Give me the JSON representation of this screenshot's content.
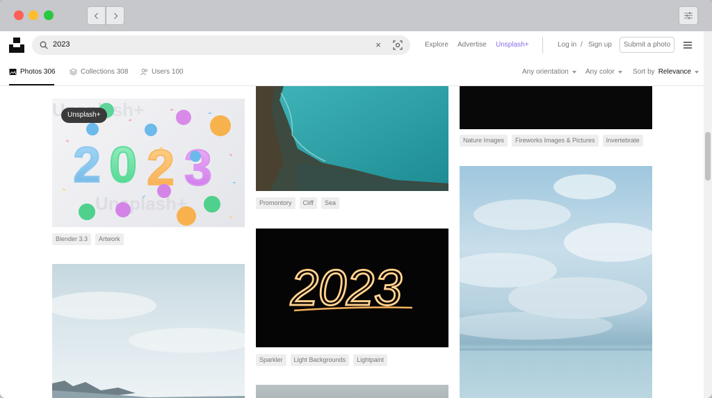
{
  "search": {
    "value": "2023",
    "clear_glyph": "×"
  },
  "topnav": {
    "explore": "Explore",
    "advertise": "Advertise",
    "plus": "Unsplash+",
    "login": "Log in",
    "slash": "/",
    "signup": "Sign up",
    "submit": "Submit a photo"
  },
  "tabs": [
    {
      "label": "Photos 306",
      "icon": "photo-icon",
      "active": true
    },
    {
      "label": "Collections 308",
      "icon": "collections-icon"
    },
    {
      "label": "Users 100",
      "icon": "users-icon"
    }
  ],
  "filters": {
    "orientation": "Any orientation",
    "color": "Any color",
    "sort_prefix": "Sort by",
    "sort_value": "Relevance"
  },
  "cards": {
    "numbers_2023": {
      "badge": "Unsplash+",
      "tags": [
        "Blender 3.3",
        "Artwork"
      ],
      "watermark": "Unsplash+"
    },
    "cliff": {
      "tags": [
        "Promontory",
        "Cliff",
        "Sea"
      ]
    },
    "fireworks": {
      "tags": [
        "Nature Images",
        "Fireworks Images & Pictures",
        "Invertebrate"
      ]
    },
    "sparkler": {
      "tags": [
        "Sparkler",
        "Light Backgrounds",
        "Lightpaint"
      ],
      "sparkle_text": "2023"
    }
  },
  "colors": {
    "accent_plus": "#8a6de9",
    "tag_bg": "#eeeeee",
    "text_muted": "#767676"
  }
}
